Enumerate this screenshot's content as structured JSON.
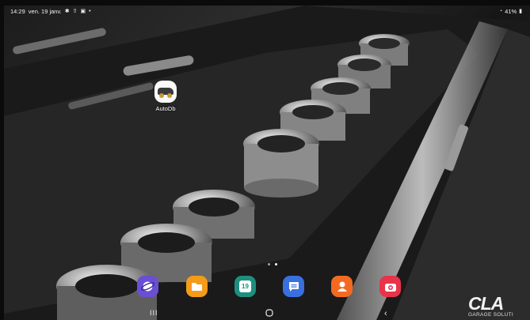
{
  "status_bar": {
    "time": "14:29",
    "date": "ven. 19 janv.",
    "battery": "41%"
  },
  "home": {
    "apps": [
      {
        "label": "AutoDb",
        "icon": "autodb-car-icon"
      }
    ]
  },
  "page_indicator": {
    "count": 2,
    "active": 1
  },
  "dock": [
    {
      "icon": "samsung-internet-icon",
      "color": "#6a4fd4"
    },
    {
      "icon": "my-files-folder-icon",
      "color": "#f49b1a"
    },
    {
      "icon": "calendar-icon",
      "color": "#1e8f7e",
      "text": "19"
    },
    {
      "icon": "messages-icon",
      "color": "#3a6fe0"
    },
    {
      "icon": "contacts-icon",
      "color": "#f26a22"
    },
    {
      "icon": "camera-icon",
      "color": "#e8334a"
    }
  ],
  "navigation": {
    "recents": "recents-icon",
    "home": "home-icon",
    "back": "back-icon"
  },
  "watermark": {
    "brand": "CLA",
    "tagline": "GARAGE SOLUTI"
  }
}
